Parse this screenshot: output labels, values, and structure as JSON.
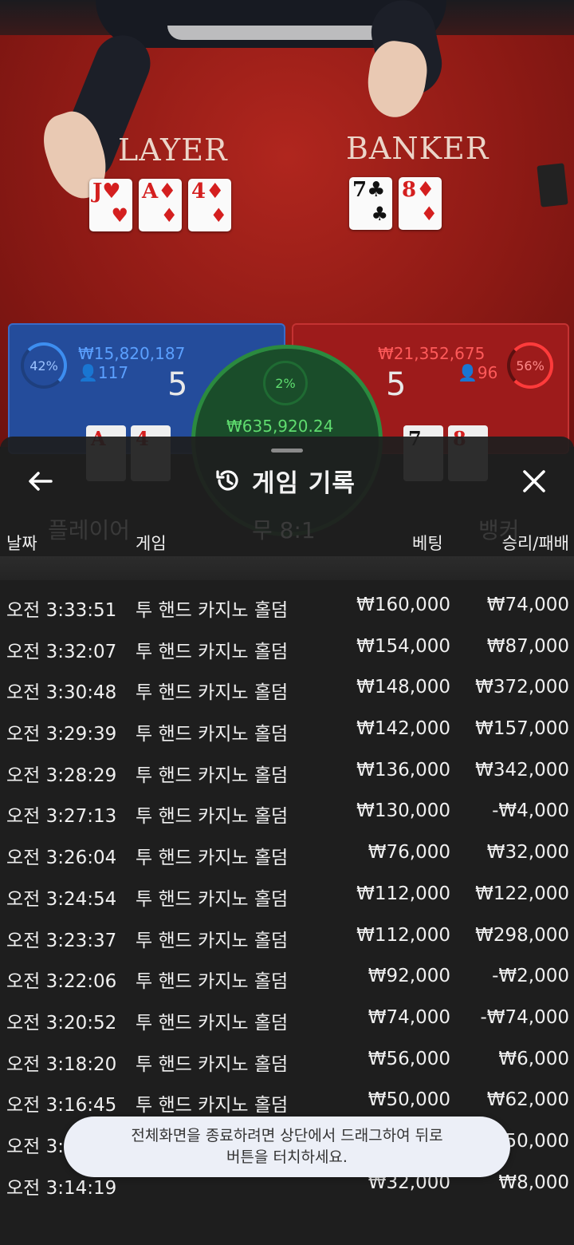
{
  "table": {
    "player_label": "LAYER",
    "banker_label": "BANKER",
    "player_cards": [
      {
        "rank": "J",
        "suit": "♥",
        "color": "red"
      },
      {
        "rank": "A",
        "suit": "♦",
        "color": "red"
      },
      {
        "rank": "4",
        "suit": "♦",
        "color": "red"
      }
    ],
    "banker_cards": [
      {
        "rank": "7",
        "suit": "♣",
        "color": "black"
      },
      {
        "rank": "8",
        "suit": "♦",
        "color": "red"
      }
    ]
  },
  "bet_panels": {
    "player": {
      "percent": "42%",
      "amount": "₩15,820,187",
      "players": "117",
      "score": "5",
      "color": "#244c9b"
    },
    "tie": {
      "percent": "2%",
      "amount": "₩635,920.24",
      "color": "#1a4d2a"
    },
    "banker": {
      "percent": "56%",
      "amount": "₩21,352,675",
      "players": "96",
      "score": "5",
      "color": "#9d1b1b"
    }
  },
  "history": {
    "title": "게임 기록",
    "icons": {
      "back": "arrow-left-icon",
      "history": "history-icon",
      "close": "close-icon"
    },
    "headers": {
      "date": "날짜",
      "game": "게임",
      "bet": "베팅",
      "result": "승리/패배"
    },
    "rows": [
      {
        "time": "오전 3:33:51",
        "game": "투 핸드 카지노 홀덤",
        "bet": "₩160,000",
        "result": "₩74,000"
      },
      {
        "time": "오전 3:32:07",
        "game": "투 핸드 카지노 홀덤",
        "bet": "₩154,000",
        "result": "₩87,000"
      },
      {
        "time": "오전 3:30:48",
        "game": "투 핸드 카지노 홀덤",
        "bet": "₩148,000",
        "result": "₩372,000"
      },
      {
        "time": "오전 3:29:39",
        "game": "투 핸드 카지노 홀덤",
        "bet": "₩142,000",
        "result": "₩157,000"
      },
      {
        "time": "오전 3:28:29",
        "game": "투 핸드 카지노 홀덤",
        "bet": "₩136,000",
        "result": "₩342,000"
      },
      {
        "time": "오전 3:27:13",
        "game": "투 핸드 카지노 홀덤",
        "bet": "₩130,000",
        "result": "-₩4,000"
      },
      {
        "time": "오전 3:26:04",
        "game": "투 핸드 카지노 홀덤",
        "bet": "₩76,000",
        "result": "₩32,000"
      },
      {
        "time": "오전 3:24:54",
        "game": "투 핸드 카지노 홀덤",
        "bet": "₩112,000",
        "result": "₩122,000"
      },
      {
        "time": "오전 3:23:37",
        "game": "투 핸드 카지노 홀덤",
        "bet": "₩112,000",
        "result": "₩298,000"
      },
      {
        "time": "오전 3:22:06",
        "game": "투 핸드 카지노 홀덤",
        "bet": "₩92,000",
        "result": "-₩2,000"
      },
      {
        "time": "오전 3:20:52",
        "game": "투 핸드 카지노 홀덤",
        "bet": "₩74,000",
        "result": "-₩74,000"
      },
      {
        "time": "오전 3:18:20",
        "game": "투 핸드 카지노 홀덤",
        "bet": "₩56,000",
        "result": "₩6,000"
      },
      {
        "time": "오전 3:16:45",
        "game": "투 핸드 카지노 홀덤",
        "bet": "₩50,000",
        "result": "₩62,000"
      },
      {
        "time": "오전 3:",
        "game": "",
        "bet": "",
        "result": "50,000"
      },
      {
        "time": "오전 3:14:19",
        "game": "",
        "bet": "₩32,000",
        "result": "₩8,000"
      }
    ]
  },
  "toast": {
    "line1": "전체화면을 종료하려면 상단에서 드래그하여 뒤로",
    "line2": "버튼을 터치하세요."
  }
}
